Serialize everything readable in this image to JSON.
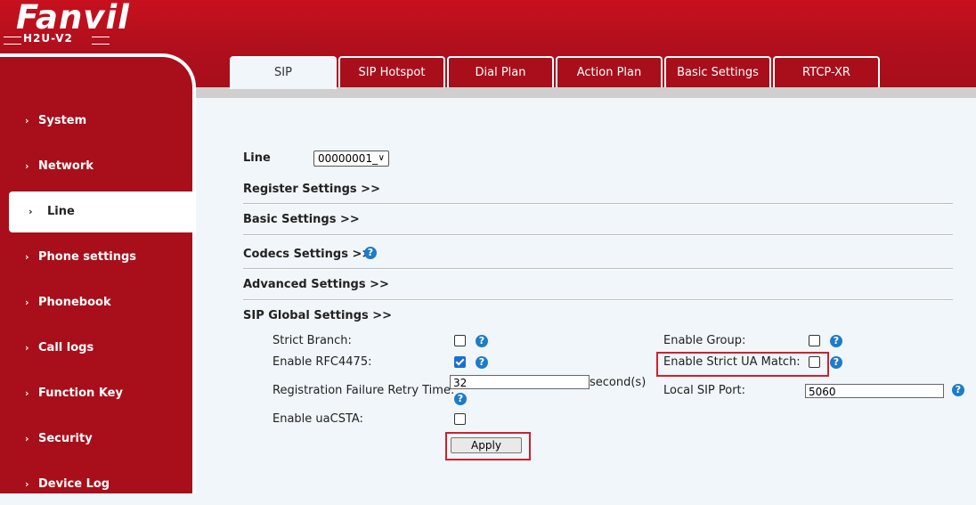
{
  "header": {
    "brand": "Fanvil",
    "model": "H2U-V2"
  },
  "tabs": [
    {
      "label": "SIP"
    },
    {
      "label": "SIP Hotspot"
    },
    {
      "label": "Dial Plan"
    },
    {
      "label": "Action Plan"
    },
    {
      "label": "Basic Settings"
    },
    {
      "label": "RTCP-XR"
    }
  ],
  "sidebar": {
    "items": [
      {
        "label": "System"
      },
      {
        "label": "Network"
      },
      {
        "label": "Line"
      },
      {
        "label": "Phone settings"
      },
      {
        "label": "Phonebook"
      },
      {
        "label": "Call logs"
      },
      {
        "label": "Function Key"
      },
      {
        "label": "Security"
      },
      {
        "label": "Device Log"
      }
    ],
    "arrow": "›"
  },
  "line": {
    "label": "Line",
    "value": "00000001_"
  },
  "sections": {
    "register": "Register Settings >>",
    "basic": "Basic Settings >>",
    "codecs": "Codecs Settings >>",
    "advanced": "Advanced Settings >>",
    "sip_global": "SIP Global Settings >>"
  },
  "sip_global": {
    "strict_branch": {
      "label": "Strict Branch:",
      "checked": false
    },
    "enable_rfc4475": {
      "label": "Enable RFC4475:",
      "checked": true
    },
    "reg_fail_retry": {
      "label": "Registration Failure Retry Time:",
      "value": "32",
      "unit": "second(s)"
    },
    "enable_uacsta": {
      "label": "Enable uaCSTA:",
      "checked": false
    },
    "enable_group": {
      "label": "Enable Group:",
      "checked": false
    },
    "enable_strict_ua": {
      "label": "Enable Strict UA Match:",
      "checked": false
    },
    "local_sip_port": {
      "label": "Local SIP Port:",
      "value": "5060"
    },
    "apply_label": "Apply",
    "help_glyph": "?"
  },
  "colors": {
    "brand_red": "#a80f1b",
    "highlight_red": "#d21f2e",
    "help_blue": "#1e7cc7"
  }
}
